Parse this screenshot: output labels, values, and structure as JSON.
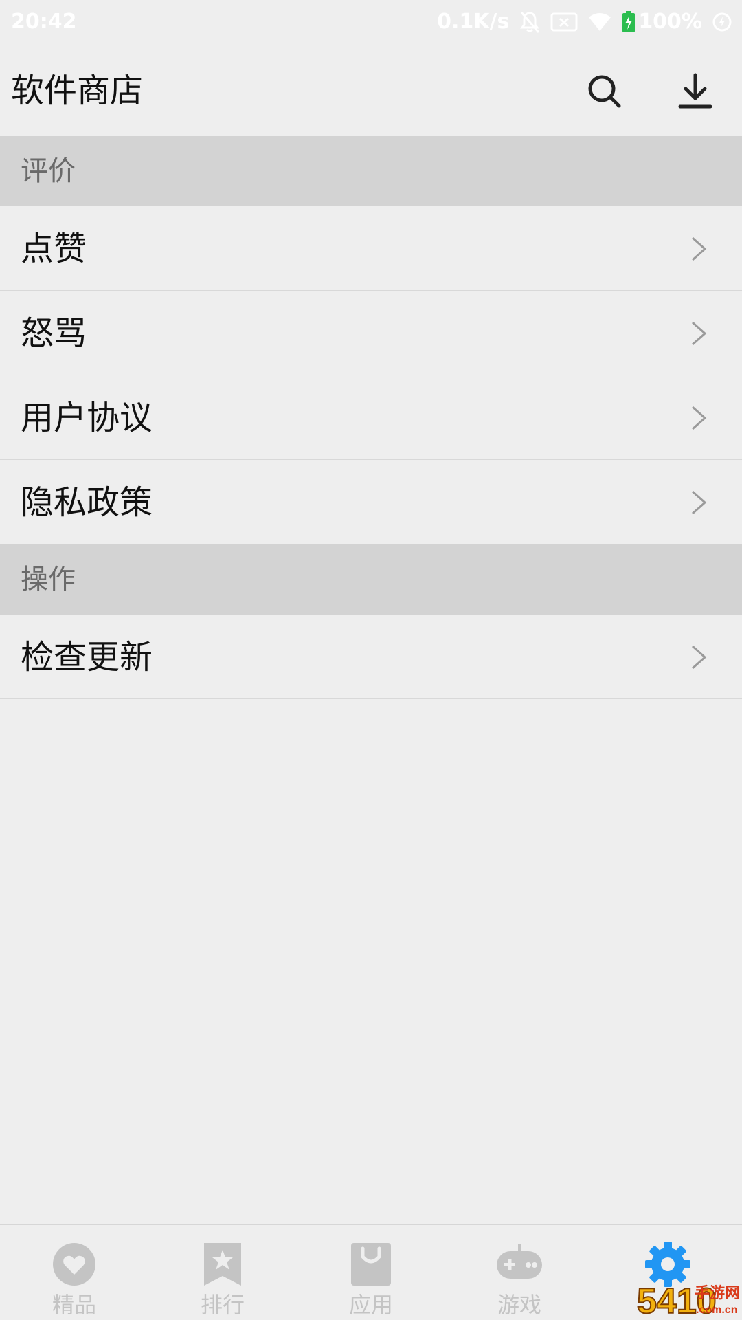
{
  "status_bar": {
    "time": "20:42",
    "net_speed": "0.1K/s",
    "battery": "100%",
    "icons": [
      "mute-bell-icon",
      "sim-x-icon",
      "wifi-icon",
      "battery-charging-icon",
      "charge-status-icon"
    ]
  },
  "app_bar": {
    "title": "软件商店",
    "actions": [
      {
        "name": "search-icon"
      },
      {
        "name": "download-icon"
      }
    ]
  },
  "sections": [
    {
      "header": "评价",
      "items": [
        {
          "label": "点赞"
        },
        {
          "label": "怒骂"
        },
        {
          "label": "用户协议"
        },
        {
          "label": "隐私政策"
        }
      ]
    },
    {
      "header": "操作",
      "items": [
        {
          "label": "检查更新"
        }
      ]
    }
  ],
  "bottom_nav": {
    "items": [
      {
        "label": "精品",
        "icon": "heart-icon",
        "active": false
      },
      {
        "label": "排行",
        "icon": "ranking-star-icon",
        "active": false
      },
      {
        "label": "应用",
        "icon": "shopping-bag-icon",
        "active": false
      },
      {
        "label": "游戏",
        "icon": "gamepad-icon",
        "active": false
      },
      {
        "label": "",
        "icon": "gear-icon",
        "active": true
      }
    ],
    "active_color": "#2196f3",
    "inactive_color": "#c4c4c4"
  },
  "watermark": {
    "text": "手游网",
    "sub_text": ".com.cn",
    "number": "5410"
  }
}
